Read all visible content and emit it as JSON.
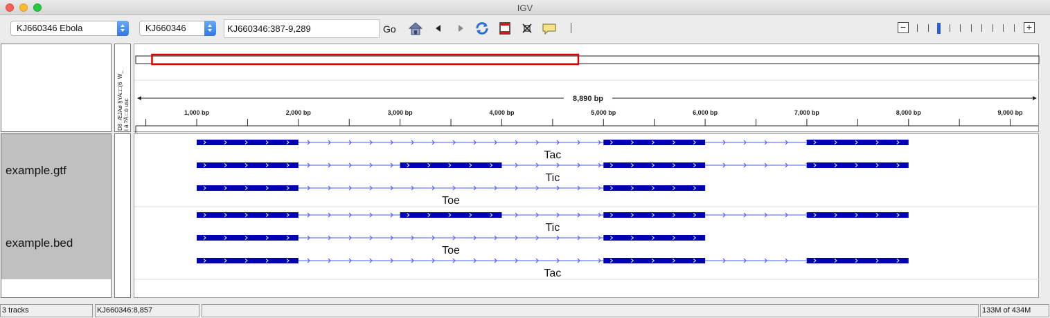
{
  "window": {
    "title": "IGV"
  },
  "toolbar": {
    "genome": "KJ660346 Ebola",
    "chromosome": "KJ660346",
    "locus": "KJ660346:387-9,289",
    "go_label": "Go",
    "icons": [
      "home-icon",
      "back-icon",
      "forward-icon",
      "refresh-icon",
      "region-of-interest-icon",
      "resize-to-window-icon",
      "popup-text-icon",
      "ruler-divider"
    ],
    "zoom": {
      "min_label": "−",
      "max_label": "+",
      "levels": 11,
      "current_level": 2
    }
  },
  "ruler": {
    "total_label": "8,890 bp",
    "tick_labels": [
      "1,000 bp",
      "2,000 bp",
      "3,000 bp",
      "4,000 bp",
      "5,000 bp",
      "6,000 bp",
      "7,000 bp",
      "8,000 bp",
      "9,000 bp"
    ],
    "view_start": 387,
    "view_end": 9289,
    "viewport_highlight": {
      "start_fraction": 0.018,
      "end_fraction": 0.49
    }
  },
  "attribute_header_text": "D8  ÆJAø §YA□□(6  W_\nl ä ?Ä □ò usc",
  "tracks": [
    {
      "name": "example.gtf",
      "features": [
        {
          "label": "Tac",
          "exons": [
            [
              1000,
              2000
            ],
            [
              5000,
              6000
            ],
            [
              7000,
              8000
            ]
          ]
        },
        {
          "label": "Tic",
          "exons": [
            [
              1000,
              2000
            ],
            [
              3000,
              4000
            ],
            [
              5000,
              6000
            ],
            [
              7000,
              8000
            ]
          ]
        },
        {
          "label": "Toe",
          "exons": [
            [
              1000,
              2000
            ],
            [
              5000,
              6000
            ]
          ]
        }
      ]
    },
    {
      "name": "example.bed",
      "features": [
        {
          "label": "Tic",
          "exons": [
            [
              1000,
              2000
            ],
            [
              3000,
              4000
            ],
            [
              5000,
              6000
            ],
            [
              7000,
              8000
            ]
          ]
        },
        {
          "label": "Toe",
          "exons": [
            [
              1000,
              2000
            ],
            [
              5000,
              6000
            ]
          ]
        },
        {
          "label": "Tac",
          "exons": [
            [
              1000,
              2000
            ],
            [
              5000,
              6000
            ],
            [
              7000,
              8000
            ]
          ]
        }
      ]
    }
  ],
  "colors": {
    "feature": "#0000b2",
    "intron_arrow": "#4b5bff",
    "viewport_box": "#e00000",
    "track_name_bg": "#c0c0c0"
  },
  "status": {
    "track_count": "3 tracks",
    "position": "KJ660346:8,857",
    "message": "",
    "memory": "133M of 434M"
  }
}
